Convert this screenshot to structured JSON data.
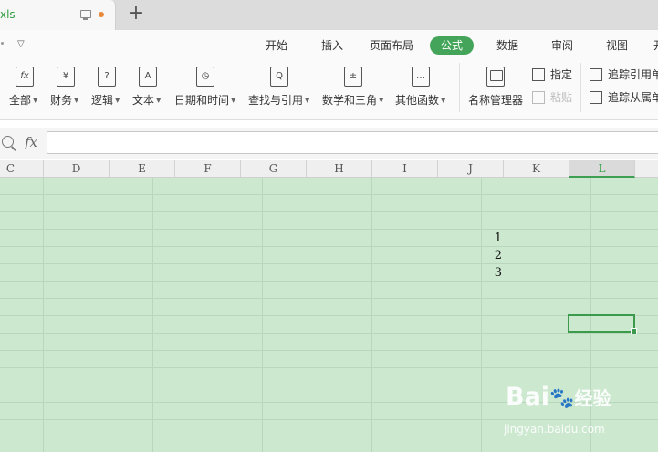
{
  "tab": {
    "doc_name": "xls"
  },
  "menu": {
    "tabs": [
      {
        "label": "开始"
      },
      {
        "label": "插入"
      },
      {
        "label": "页面布局"
      },
      {
        "label": "公式"
      },
      {
        "label": "数据"
      },
      {
        "label": "审阅"
      },
      {
        "label": "视图"
      },
      {
        "label": "开"
      }
    ],
    "active": "公式"
  },
  "ribbon": {
    "functions": [
      {
        "label": "全部",
        "icon": "fx-icon",
        "glyph": "fx"
      },
      {
        "label": "财务",
        "icon": "yen-icon",
        "glyph": "¥"
      },
      {
        "label": "逻辑",
        "icon": "question-icon",
        "glyph": "?"
      },
      {
        "label": "文本",
        "icon": "text-a-icon",
        "glyph": "A"
      },
      {
        "label": "日期和时间",
        "icon": "clock-icon",
        "glyph": "◷"
      },
      {
        "label": "查找与引用",
        "icon": "search-book-icon",
        "glyph": "Q"
      },
      {
        "label": "数学和三角",
        "icon": "math-icon",
        "glyph": "±"
      },
      {
        "label": "其他函数",
        "icon": "more-functions-icon",
        "glyph": "…"
      }
    ],
    "name_manager": "名称管理器",
    "specify": "指定",
    "paste": "粘贴",
    "trace_precedents": "追踪引用单",
    "trace_dependents": "追踪从属单"
  },
  "formula_bar": {
    "fx_label": "fx",
    "value": ""
  },
  "columns": [
    "C",
    "D",
    "E",
    "F",
    "G",
    "H",
    "I",
    "J",
    "K",
    "L"
  ],
  "selected_column": "L",
  "cells": [
    {
      "col": "J",
      "row_index": 3,
      "value": "1"
    },
    {
      "col": "J",
      "row_index": 4,
      "value": "2"
    },
    {
      "col": "J",
      "row_index": 5,
      "value": "3"
    }
  ],
  "watermark": {
    "logo": "Bai",
    "logo_cn": "经验",
    "site": "jingyan.baidu.com"
  },
  "colors": {
    "accent": "#44a55a",
    "sheet_bg": "#cce8cf",
    "unsaved_dot": "#e8883a"
  }
}
